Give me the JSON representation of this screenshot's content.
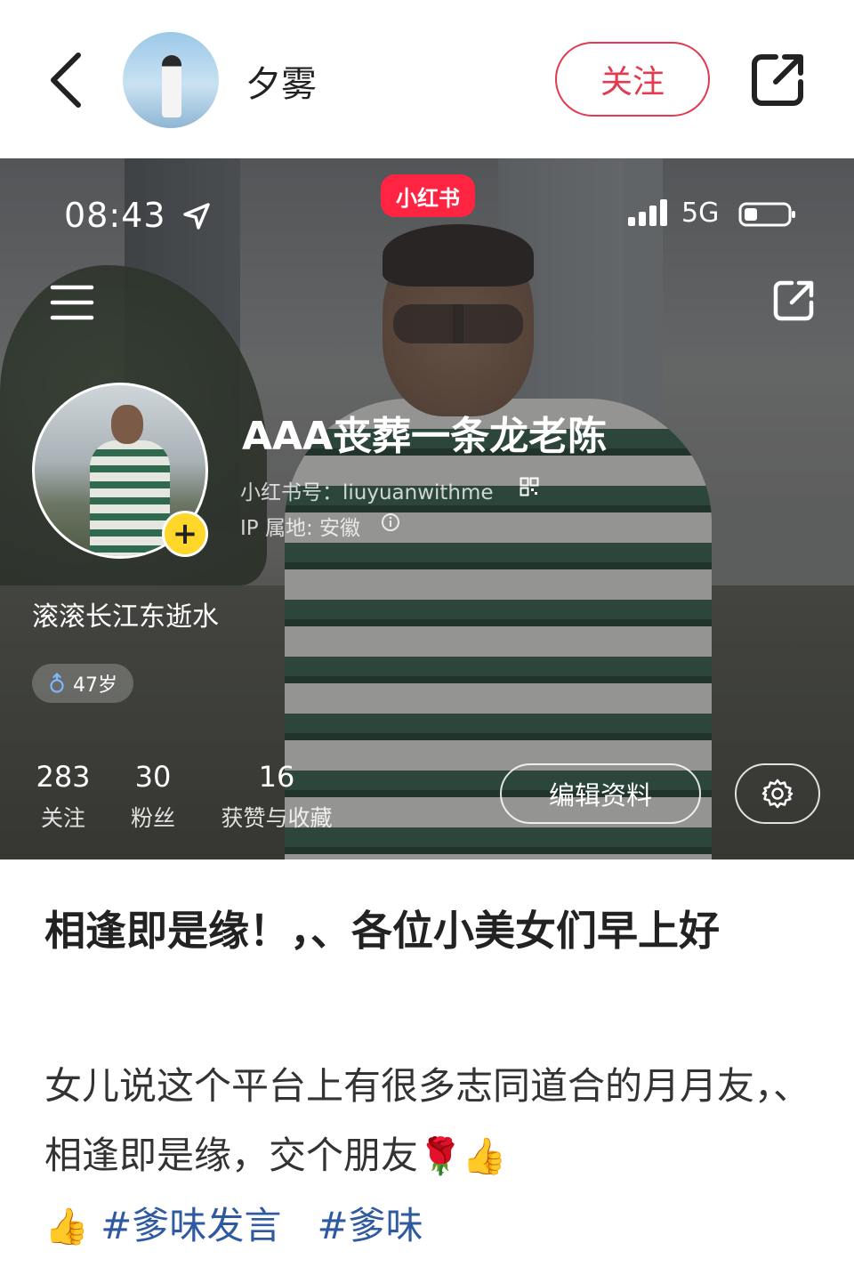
{
  "header": {
    "username": "夕雾",
    "follow_label": "关注",
    "icons": {
      "back": "chevron-left-icon",
      "share": "share-icon"
    }
  },
  "screenshot": {
    "status": {
      "time": "08:43",
      "network": "5G"
    },
    "app_logo": "小红书",
    "profile": {
      "name": "AAA丧葬一条龙老陈",
      "redbook_id": "小红书号：liuyuanwithme",
      "ip": "IP 属地: 安徽",
      "bio": "滚滚长江东逝水",
      "age": "47岁"
    },
    "stats": [
      {
        "value": "283",
        "label": "关注"
      },
      {
        "value": "30",
        "label": "粉丝"
      },
      {
        "value": "16",
        "label": "获赞与收藏"
      }
    ],
    "edit_label": "编辑资料",
    "colors": {
      "brand": "#ff2442",
      "badge": "#ffd72a"
    }
  },
  "post": {
    "title": "相逢即是缘！，、各位小美女们早上好",
    "body": "女儿说这个平台上有很多志同道合的月月友，、相逢即是缘，交个朋友",
    "emojis_inline": "🌹👍",
    "emoji_lead": "👍",
    "hashtags": [
      "#爹味发言",
      "#爹味"
    ]
  },
  "colors": {
    "accent": "#e23a4e",
    "hashtag": "#2f5aa0"
  }
}
